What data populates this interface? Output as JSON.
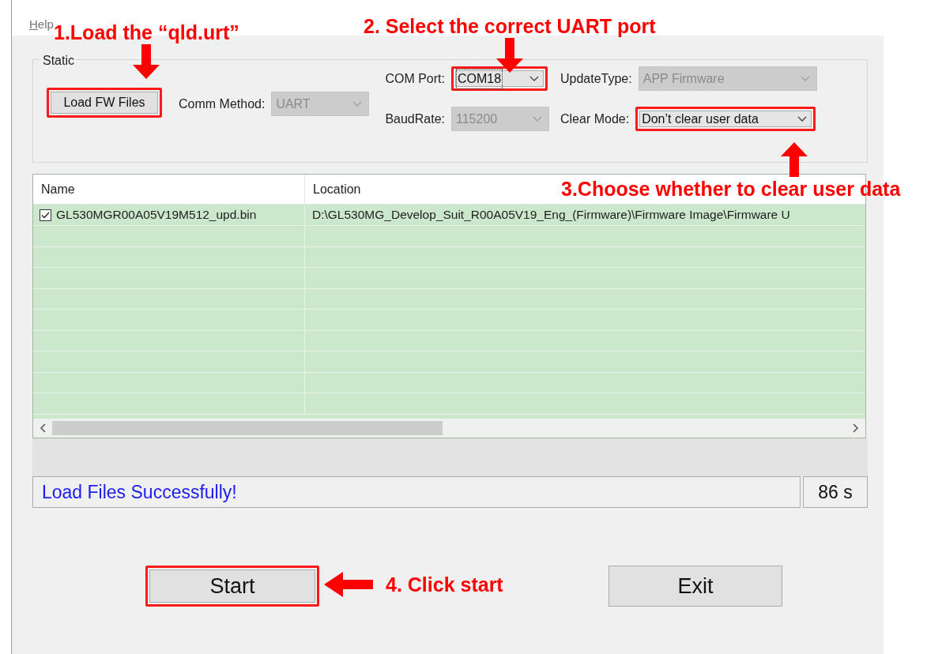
{
  "menu": [
    {
      "label": "Help"
    }
  ],
  "group": {
    "title": "Static",
    "load_button": {
      "label": "Load FW Files",
      "highlighted": true
    },
    "fields": [
      {
        "label": "Comm Method:",
        "value": "UART",
        "disabled": true,
        "highlighted": false,
        "focused": false
      },
      {
        "label": "COM Port:",
        "value": "COM18",
        "disabled": false,
        "highlighted": true,
        "focused": true
      },
      {
        "label": "UpdateType:",
        "value": "APP Firmware",
        "disabled": true,
        "highlighted": false,
        "focused": false
      },
      {
        "label": "BaudRate:",
        "value": "115200",
        "disabled": true,
        "highlighted": false,
        "focused": false
      },
      {
        "label": "Clear Mode:",
        "value": "Don’t clear user data",
        "disabled": false,
        "highlighted": true,
        "focused": false
      }
    ]
  },
  "file_list": {
    "columns": [
      "Name",
      "Location"
    ],
    "rows": [
      {
        "name": "GL530MGR00A05V19M512_upd.bin",
        "location": "D:\\GL530MG_Develop_Suit_R00A05V19_Eng_(Firmware)\\Firmware Image\\Firmware U",
        "checked": true
      }
    ]
  },
  "status": {
    "message": "Load Files Successfully!",
    "time": "86 s"
  },
  "buttons": [
    {
      "label": "Start",
      "highlighted": true
    },
    {
      "label": "Exit",
      "highlighted": false
    }
  ],
  "annotations": [
    {
      "text": "1.Load the “qld.urt”",
      "kind": "down"
    },
    {
      "text": "2. Select the correct UART port",
      "kind": "down"
    },
    {
      "text": "3.Choose whether to clear user data",
      "kind": "up"
    },
    {
      "text": "4. Click start",
      "kind": "left"
    }
  ]
}
